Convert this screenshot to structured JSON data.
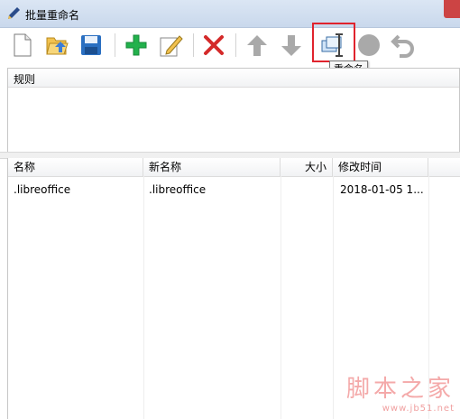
{
  "window": {
    "title": "批量重命名",
    "app_icon": "pen-icon"
  },
  "toolbar": {
    "buttons": [
      {
        "icon": "new-file-icon",
        "label": ""
      },
      {
        "icon": "open-folder-icon",
        "label": ""
      },
      {
        "icon": "save-icon",
        "label": ""
      },
      {
        "icon": "add-icon",
        "label": ""
      },
      {
        "icon": "edit-icon",
        "label": ""
      },
      {
        "icon": "delete-icon",
        "label": ""
      },
      {
        "icon": "move-up-icon",
        "label": ""
      },
      {
        "icon": "move-down-icon",
        "label": ""
      },
      {
        "icon": "rename-icon",
        "label": ""
      },
      {
        "icon": "record-icon",
        "label": ""
      },
      {
        "icon": "undo-icon",
        "label": ""
      }
    ],
    "tooltip": "重命名"
  },
  "rules": {
    "header": "规则"
  },
  "files": {
    "columns": [
      "名称",
      "新名称",
      "大小",
      "修改时间"
    ],
    "rows": [
      {
        "name": ".libreoffice",
        "new_name": ".libreoffice",
        "size": "",
        "modified": "2018-01-05  1..."
      }
    ]
  },
  "watermark": {
    "main": "脚本之家",
    "sub": "www.jb51.net"
  },
  "colors": {
    "highlight": "#e0232d",
    "add": "#22b14c",
    "delete": "#d42a2a",
    "save": "#2a6fc1"
  }
}
